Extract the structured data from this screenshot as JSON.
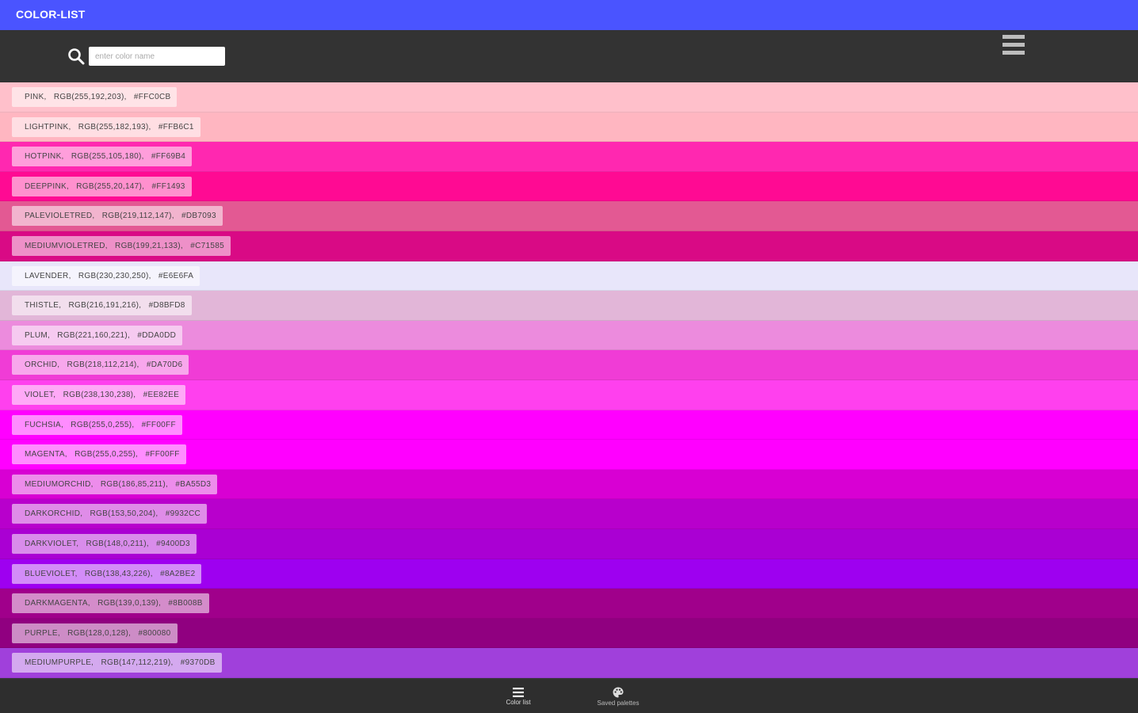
{
  "app": {
    "title": "COLOR-LIST"
  },
  "search": {
    "placeholder": "enter color name",
    "value": ""
  },
  "colors": [
    {
      "label": "PINK,   RGB(255,192,203),   #FFC0CB",
      "hex": "#FFC0CB"
    },
    {
      "label": "LIGHTPINK,   RGB(255,182,193),   #FFB6C1",
      "hex": "#FFB6C1"
    },
    {
      "label": "HOTPINK,   RGB(255,105,180),   #FF69B4",
      "hex": "#FF28B0"
    },
    {
      "label": "DEEPPINK,   RGB(255,20,147),   #FF1493",
      "hex": "#FF0A93"
    },
    {
      "label": "PALEVIOLETRED,   RGB(219,112,147),   #DB7093",
      "hex": "#E35993"
    },
    {
      "label": "MEDIUMVIOLETRED,   RGB(199,21,133),   #C71585",
      "hex": "#D90A85"
    },
    {
      "label": "LAVENDER,   RGB(230,230,250),   #E6E6FA",
      "hex": "#E8E6FA"
    },
    {
      "label": "THISTLE,   RGB(216,191,216),   #D8BFD8",
      "hex": "#E2B6D8"
    },
    {
      "label": "PLUM,   RGB(221,160,221),   #DDA0DD",
      "hex": "#EC8BDD"
    },
    {
      "label": "ORCHID,   RGB(218,112,214),   #DA70D6",
      "hex": "#F03CD6"
    },
    {
      "label": "VIOLET,   RGB(238,130,238),   #EE82EE",
      "hex": "#FF40EE"
    },
    {
      "label": "FUCHSIA,   RGB(255,0,255),   #FF00FF",
      "hex": "#FF00FF"
    },
    {
      "label": "MAGENTA,   RGB(255,0,255),   #FF00FF",
      "hex": "#FF00FF"
    },
    {
      "label": "MEDIUMORCHID,   RGB(186,85,211),   #BA55D3",
      "hex": "#D800D3"
    },
    {
      "label": "DARKORCHID,   RGB(153,50,204),   #9932CC",
      "hex": "#B800CC"
    },
    {
      "label": "DARKVIOLET,   RGB(148,0,211),   #9400D3",
      "hex": "#AA00D3"
    },
    {
      "label": "BLUEVIOLET,   RGB(138,43,226),   #8A2BE2",
      "hex": "#9E00F0"
    },
    {
      "label": "DARKMAGENTA,   RGB(139,0,139),   #8B008B",
      "hex": "#A0008B"
    },
    {
      "label": "PURPLE,   RGB(128,0,128),   #800080",
      "hex": "#900080"
    },
    {
      "label": "MEDIUMPURPLE,   RGB(147,112,219),   #9370DB",
      "hex": "#A040DB"
    }
  ],
  "bottom_nav": {
    "items": [
      {
        "label": "Color list",
        "icon": "list-icon"
      },
      {
        "label": "Saved palettes",
        "icon": "palette-icon"
      }
    ]
  },
  "theme": {
    "titlebar": "#4A54FF",
    "toolbar": "#333333",
    "bottom_nav": "#2E2E2E"
  }
}
